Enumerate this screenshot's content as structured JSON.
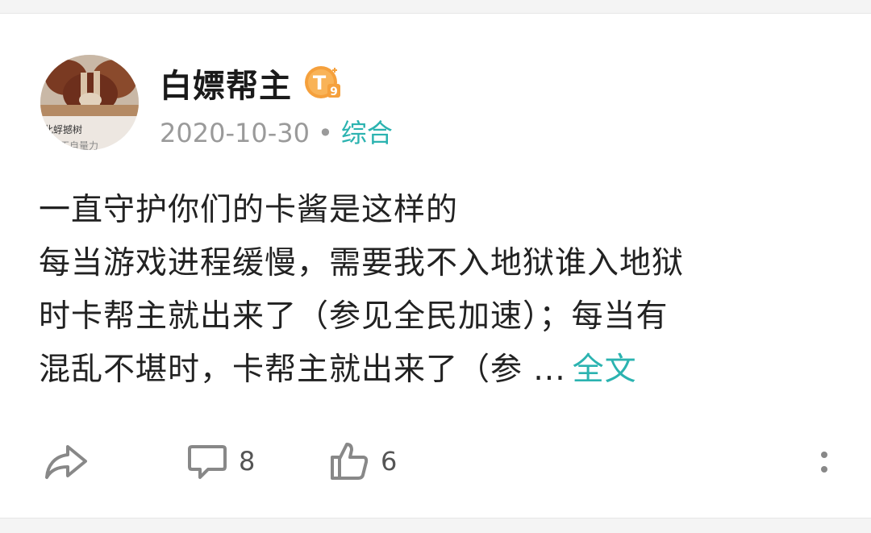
{
  "post": {
    "author": {
      "name": "白嫖帮主",
      "avatar_caption": "此蜉撼树",
      "avatar_subcaption": "不自量力",
      "badge_letter": "T",
      "badge_number": "9"
    },
    "date": "2020-10-30",
    "separator": "•",
    "category": "综合",
    "text_lines": [
      "一直守护你们的卡酱是这样的",
      "每当游戏进程缓慢，需要我不入地狱谁入地狱",
      "时卡帮主就出来了（参见全民加速）；每当有",
      "混乱不堪时，卡帮主就出来了（参 ..."
    ],
    "more_label": "全文",
    "comments_count": "8",
    "likes_count": "6"
  },
  "icons": {
    "share": "share-arrow-icon",
    "comment": "comment-bubble-icon",
    "like": "thumbs-up-icon",
    "more": "vertical-dots-icon"
  },
  "colors": {
    "accent": "#2bb3b0",
    "badge": "#f5a03c",
    "meta": "#9a9a9a"
  }
}
